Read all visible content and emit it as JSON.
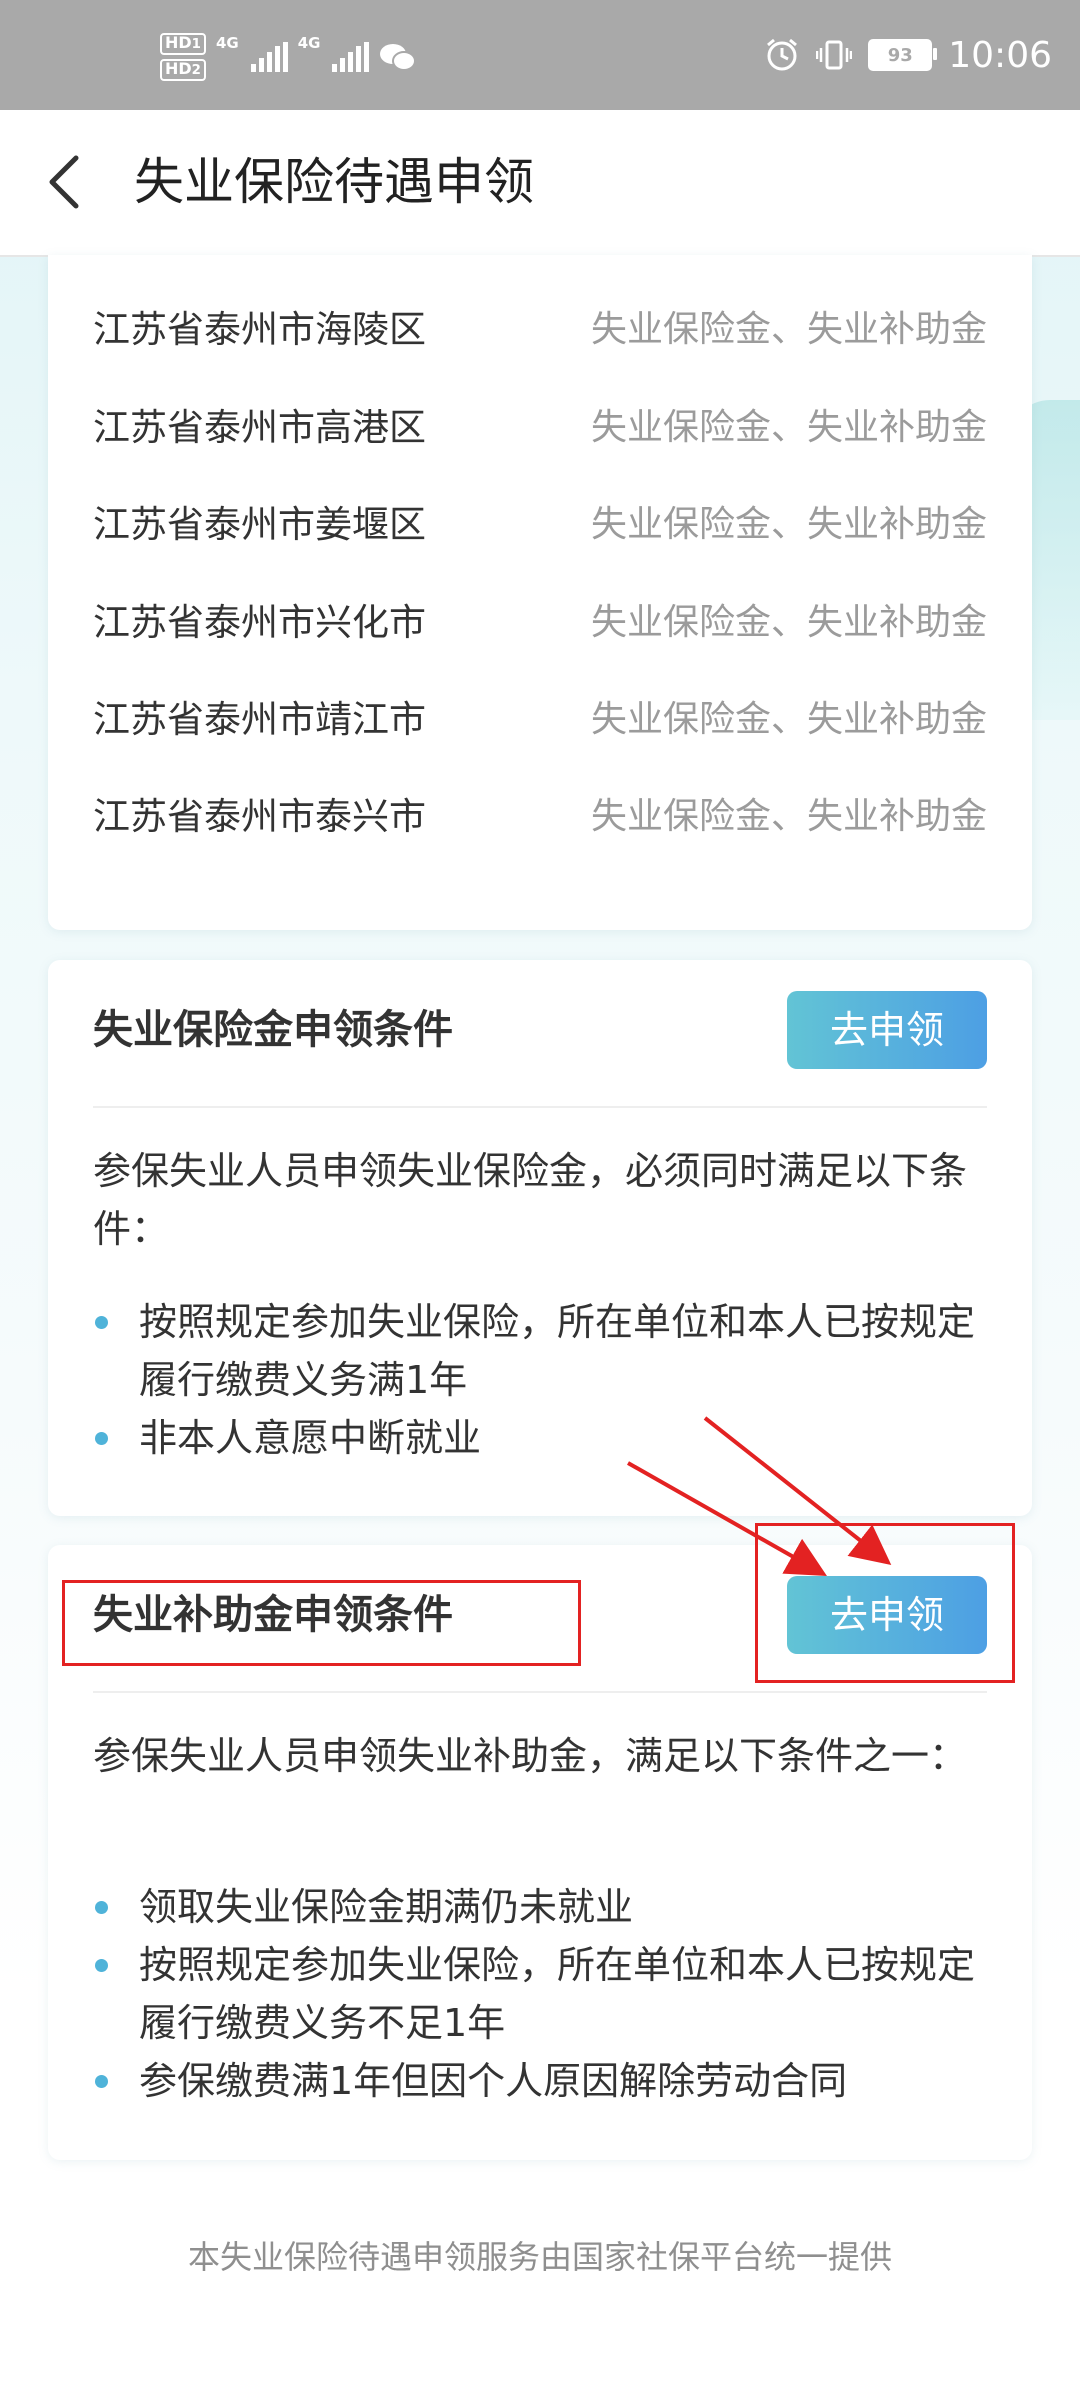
{
  "status_bar": {
    "hd1": "HD",
    "hd1_sub": "1",
    "hd2": "HD",
    "hd2_sub": "2",
    "sig1_label": "4G",
    "sig2_label": "4G",
    "battery": "93",
    "time": "10:06"
  },
  "header": {
    "back_icon": "chevron-left-icon",
    "title": "失业保险待遇申领"
  },
  "region_list": [
    {
      "area": "江苏省泰州市海陵区",
      "type": "失业保险金、失业补助金"
    },
    {
      "area": "江苏省泰州市高港区",
      "type": "失业保险金、失业补助金"
    },
    {
      "area": "江苏省泰州市姜堰区",
      "type": "失业保险金、失业补助金"
    },
    {
      "area": "江苏省泰州市兴化市",
      "type": "失业保险金、失业补助金"
    },
    {
      "area": "江苏省泰州市靖江市",
      "type": "失业保险金、失业补助金"
    },
    {
      "area": "江苏省泰州市泰兴市",
      "type": "失业保险金、失业补助金"
    }
  ],
  "insurance_card": {
    "title": "失业保险金申领条件",
    "button": "去申领",
    "desc": "参保失业人员申领失业保险金，必须同时满足以下条件：",
    "bullets": [
      "按照规定参加失业保险，所在单位和本人已按规定履行缴费义务满1年",
      "非本人意愿中断就业"
    ]
  },
  "subsidy_card": {
    "title": "失业补助金申领条件",
    "button": "去申领",
    "desc": "参保失业人员申领失业补助金，满足以下条件之一：",
    "bullets": [
      "领取失业保险金期满仍未就业",
      "按照规定参加失业保险，所在单位和本人已按规定履行缴费义务不足1年",
      "参保缴费满1年但因个人原因解除劳动合同"
    ]
  },
  "footer": "本失业保险待遇申领服务由国家社保平台统一提供",
  "colors": {
    "accent_start": "#62c4d5",
    "accent_end": "#4d9fe4",
    "annotation_red": "#e32222"
  }
}
